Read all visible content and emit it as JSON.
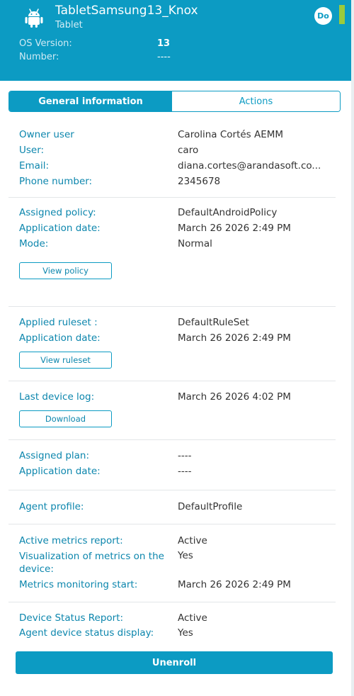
{
  "device": {
    "name": "TabletSamsung13_Knox",
    "type": "Tablet",
    "os_label": "OS Version:",
    "os_value": "13",
    "number_label": "Number:",
    "number_value": "----",
    "badge": "Do",
    "status_color": "#9ccb3b",
    "icon": "android-icon"
  },
  "tabs": [
    {
      "label": "General information",
      "active": true
    },
    {
      "label": "Actions",
      "active": false
    }
  ],
  "owner": {
    "owner_user_label": "Owner user",
    "owner_user": "Carolina Cortés AEMM",
    "user_label": "User:",
    "user": "caro",
    "email_label": "Email:",
    "email": "diana.cortes@arandasoft.co...",
    "phone_label": "Phone number:",
    "phone": "2345678"
  },
  "policy": {
    "assigned_label": "Assigned policy:",
    "assigned": "DefaultAndroidPolicy",
    "date_label": "Application date:",
    "date": "March 26 2026 2:49 PM",
    "mode_label": "Mode:",
    "mode": "Normal",
    "button": "View policy"
  },
  "ruleset": {
    "applied_label": "Applied ruleset :",
    "applied": "DefaultRuleSet",
    "date_label": "Application date:",
    "date": "March 26 2026 2:49 PM",
    "button": "View ruleset"
  },
  "log": {
    "label": "Last device log:",
    "value": "March 26 2026 4:02 PM",
    "button": "Download"
  },
  "plan": {
    "assigned_label": "Assigned plan:",
    "assigned": "----",
    "date_label": "Application date:",
    "date": "----"
  },
  "agent": {
    "label": "Agent profile:",
    "value": "DefaultProfile"
  },
  "metrics": {
    "active_label": "Active metrics report:",
    "active": "Active",
    "visualization_label": "Visualization of metrics on the device:",
    "visualization": "Yes",
    "start_label": "Metrics monitoring start:",
    "start": "March 26 2026 2:49 PM"
  },
  "status_report": {
    "label": "Device Status Report:",
    "value": "Active",
    "display_label": "Agent device status display:",
    "display": "Yes"
  },
  "footer": {
    "unenroll": "Unenroll"
  },
  "colors": {
    "accent": "#0c9bc3",
    "label": "#0c86ad"
  }
}
